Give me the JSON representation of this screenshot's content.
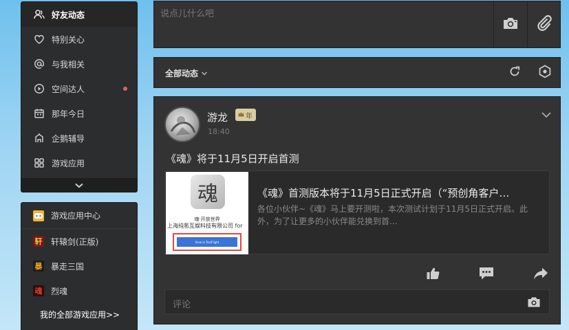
{
  "sidebar": {
    "nav_items": [
      {
        "label": "好友动态",
        "icon": "friends-icon",
        "active": true
      },
      {
        "label": "特别关心",
        "icon": "heart-icon"
      },
      {
        "label": "与我相关",
        "icon": "at-icon"
      },
      {
        "label": "空间达人",
        "icon": "play-circle-icon",
        "has_dot": true
      },
      {
        "label": "那年今日",
        "icon": "calendar-icon"
      },
      {
        "label": "企鹅辅导",
        "icon": "building-icon"
      },
      {
        "label": "游戏应用",
        "icon": "grid-icon"
      }
    ],
    "expand_icon": "chevron-down-icon",
    "game_center": {
      "header": "游戏应用中心",
      "games": [
        {
          "label": "轩辕剑(正版)",
          "icon_char": "轩"
        },
        {
          "label": "暴走三国",
          "icon_char": "暴"
        },
        {
          "label": "烈魂",
          "icon_char": "魂"
        }
      ],
      "all_games_link": "我的全部游戏应用>>"
    }
  },
  "composer": {
    "placeholder": "说点儿什么吧",
    "photo_icon": "camera-icon",
    "attach_icon": "paperclip-icon"
  },
  "filter": {
    "label": "全部动态",
    "refresh_icon": "refresh-icon",
    "settings_icon": "settings-icon"
  },
  "post": {
    "author": "游龙",
    "badge_text": "年",
    "time": "18:40",
    "text": "《魂》将于11月5日开启首测",
    "share": {
      "title": "《魂》首测版本将于11月5日正式开启（“预创角客户…",
      "description": "各位小伙伴~《魂》马上要开测啦，本次测试计划于11月5日正式开启。此外，为了让更多的小伙伴能兑换到首...",
      "thumb_glyph": "魂",
      "thumb_line1": "魂·开放世界",
      "thumb_line2": "上海纯氪互娱科技有限公司 for",
      "thumb_button": "View in TestFlight"
    },
    "comment_placeholder": "评论"
  },
  "colors": {
    "accent_dot": "#e06161",
    "panel_bg": "#333333",
    "thumb_highlight": "#e24a3a"
  }
}
